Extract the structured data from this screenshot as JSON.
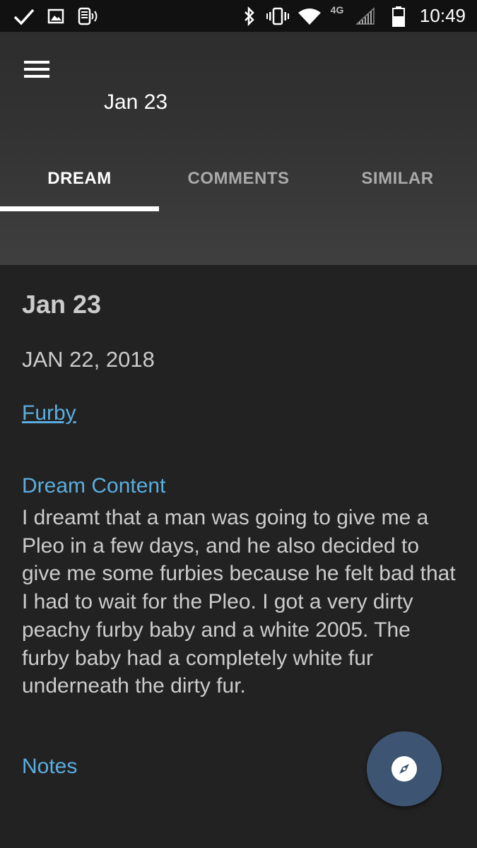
{
  "status_bar": {
    "time": "10:49",
    "network_label": "4G",
    "icons": [
      "check-icon",
      "image-icon",
      "voicemail-icon",
      "bluetooth-icon",
      "vibrate-icon",
      "wifi-icon",
      "signal-icon",
      "battery-icon"
    ]
  },
  "app_bar": {
    "title": "Jan 23",
    "menu_icon": "hamburger-menu-icon"
  },
  "tabs": [
    {
      "label": "DREAM",
      "active": true
    },
    {
      "label": "COMMENTS",
      "active": false
    },
    {
      "label": "SIMILAR",
      "active": false
    }
  ],
  "dream": {
    "title": "Jan 23",
    "date": "JAN 22, 2018",
    "tag": "Furby",
    "content_label": "Dream Content",
    "content": "I dreamt that a man was going to give me a Pleo in a few days, and he also decided to give me some furbies because he felt bad that I had to wait for the Pleo. I got a very dirty peachy furby baby and a white 2005. The furby baby had a completely white fur underneath the dirty fur.",
    "notes_label": "Notes"
  },
  "fab": {
    "icon": "compass-icon"
  },
  "colors": {
    "background": "#222222",
    "status_bar": "#111111",
    "accent_link": "#5aaee0",
    "fab": "#3d5572",
    "text": "#cccccc"
  }
}
